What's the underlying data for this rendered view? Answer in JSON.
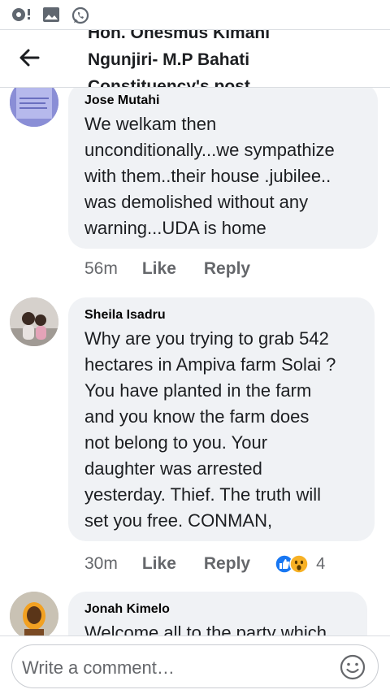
{
  "status_bar": {
    "icons": [
      "notification-icon",
      "gallery-icon",
      "whatsapp-icon"
    ]
  },
  "header": {
    "title_lines": [
      "Hon. Onesmus Kimani",
      "Ngunjiri- M.P Bahati",
      "Constituency's post"
    ]
  },
  "comments": [
    {
      "author": "Jose Mutahi",
      "text": "We welkam then\nunconditionally...we sympathize\nwith them..their house .jubilee..\nwas demolished without any\nwarning...UDA is home",
      "time": "56m",
      "like_label": "Like",
      "reply_label": "Reply"
    },
    {
      "author": "Sheila Isadru",
      "text": "Why are you trying to grab 542\nhectares in Ampiva farm Solai ?\nYou have planted in the farm\nand you know  the farm does\nnot belong to you. Your\ndaughter was arrested\nyesterday. Thief. The truth will\nset you free. CONMAN,",
      "time": "30m",
      "like_label": "Like",
      "reply_label": "Reply",
      "reaction_count": "4",
      "reactions": [
        "like-reaction",
        "wow-reaction"
      ]
    },
    {
      "author": "Jonah Kimelo",
      "text": "Welcome all to the party which"
    }
  ],
  "composer": {
    "placeholder": "Write a comment…"
  },
  "colors": {
    "bubble": "#f0f2f5",
    "meta_text": "#65676b",
    "like_blue": "#1877f2",
    "wow_yellow": "#f7b125",
    "whatsapp_green": "#25d366"
  }
}
